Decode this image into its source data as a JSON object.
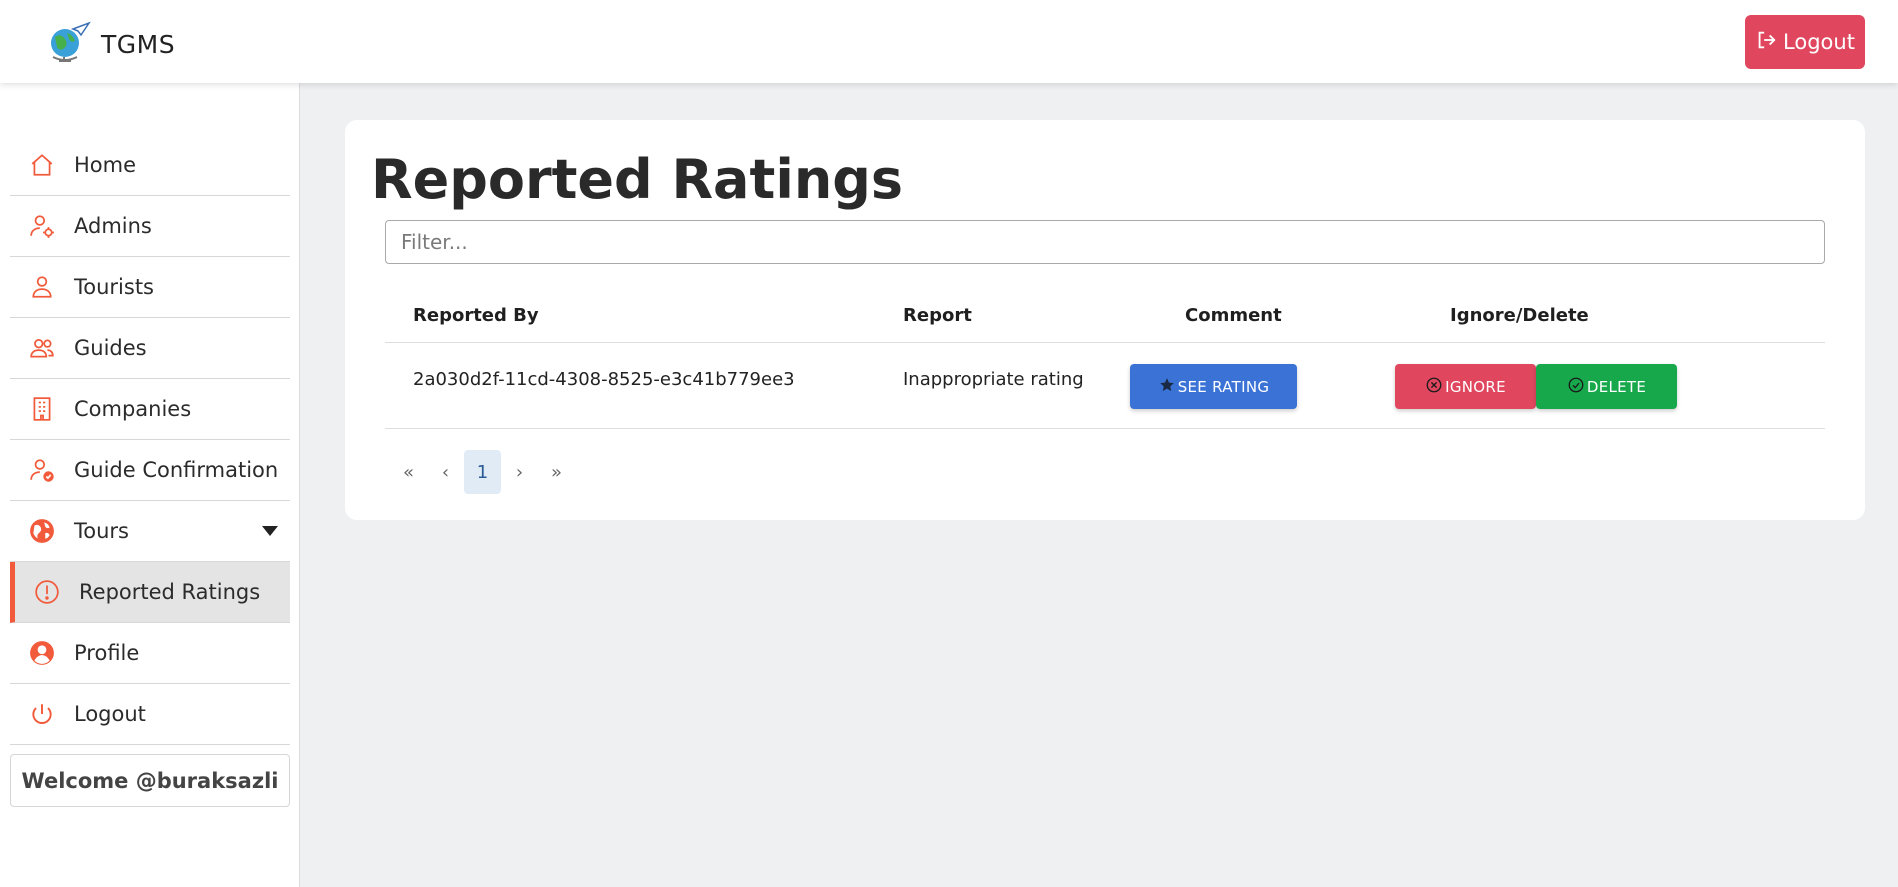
{
  "app": {
    "title": "TGMS",
    "logo_icon": "globe-plane-icon"
  },
  "header": {
    "logout_label": "Logout",
    "logout_icon": "logout-icon",
    "logout_color": "#e0475f"
  },
  "sidebar": {
    "accent": "#f15a3b",
    "items": [
      {
        "label": "Home",
        "icon": "home-icon"
      },
      {
        "label": "Admins",
        "icon": "user-gear-icon"
      },
      {
        "label": "Tourists",
        "icon": "user-icon"
      },
      {
        "label": "Guides",
        "icon": "users-icon"
      },
      {
        "label": "Companies",
        "icon": "building-icon"
      },
      {
        "label": "Guide Confirmation",
        "icon": "user-check-icon"
      },
      {
        "label": "Tours",
        "icon": "globe-icon",
        "has_dropdown": true
      },
      {
        "label": "Reported Ratings",
        "icon": "alert-circle-icon",
        "active": true
      },
      {
        "label": "Profile",
        "icon": "user-circle-icon"
      },
      {
        "label": "Logout",
        "icon": "power-icon"
      }
    ],
    "welcome": "Welcome @buraksazli"
  },
  "main": {
    "title": "Reported Ratings",
    "filter": {
      "placeholder": "Filter...",
      "value": ""
    },
    "table": {
      "headers": [
        "Reported By",
        "Report",
        "Comment",
        "Ignore/Delete"
      ],
      "rows": [
        {
          "reported_by": "2a030d2f-11cd-4308-8525-e3c41b779ee3",
          "report": "Inappropriate rating",
          "comment_button": "SEE RATING",
          "ignore_button": "IGNORE",
          "delete_button": "DELETE"
        }
      ]
    },
    "pagination": {
      "first": "«",
      "prev": "‹",
      "current": "1",
      "next": "›",
      "last": "»"
    }
  },
  "colors": {
    "see_rating": "#3a72d6",
    "ignore": "#e0475f",
    "delete": "#17a84b"
  }
}
